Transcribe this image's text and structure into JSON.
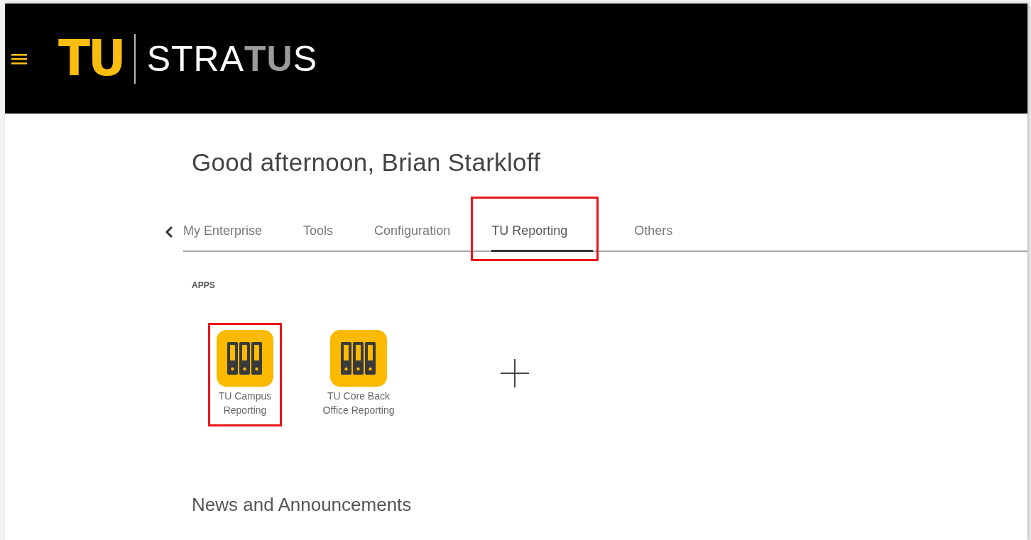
{
  "header": {
    "logo_mark": "TU",
    "logo_name": [
      {
        "text": "STRA",
        "color": "#ffffff"
      },
      {
        "text": "TU",
        "color": "#9a9a9a"
      },
      {
        "text": "S",
        "color": "#ffffff"
      }
    ]
  },
  "greeting": "Good afternoon, Brian Starkloff",
  "tabs": [
    {
      "label": "My Enterprise",
      "selected": false,
      "highlighted": false
    },
    {
      "label": "Tools",
      "selected": false,
      "highlighted": false
    },
    {
      "label": "Configuration",
      "selected": false,
      "highlighted": false
    },
    {
      "label": "TU Reporting",
      "selected": true,
      "highlighted": true
    },
    {
      "label": "Others",
      "selected": false,
      "highlighted": false
    }
  ],
  "apps_heading": "APPS",
  "apps": [
    {
      "kind": "app",
      "label": "TU Campus Reporting",
      "highlighted": true
    },
    {
      "kind": "app",
      "label": "TU Core Back Office Reporting",
      "highlighted": false
    },
    {
      "kind": "add"
    }
  ],
  "news_heading": "News and Announcements"
}
